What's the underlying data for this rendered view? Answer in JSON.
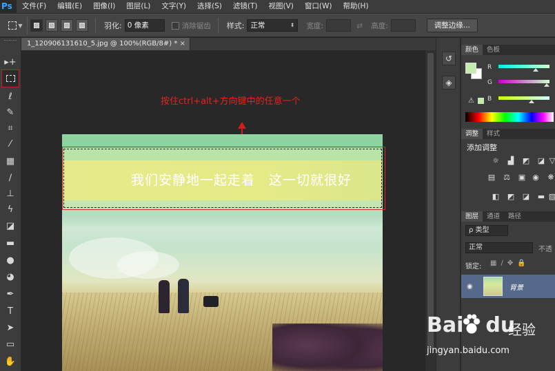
{
  "app": {
    "logo": "Ps"
  },
  "menu": [
    "文件(F)",
    "编辑(E)",
    "图像(I)",
    "图层(L)",
    "文字(Y)",
    "选择(S)",
    "滤镜(T)",
    "视图(V)",
    "窗口(W)",
    "帮助(H)"
  ],
  "options": {
    "feather_label": "羽化:",
    "feather_value": "0 像素",
    "antialias_label": "消除锯齿",
    "style_label": "样式:",
    "style_value": "正常",
    "width_label": "宽度:",
    "height_label": "高度:",
    "refine_edge": "调整边缘..."
  },
  "document": {
    "tab_title": "1_120906131610_5.jpg @ 100%(RGB/8#) *",
    "close": "×",
    "annotation": "按住ctrl+alt+方向键中的任意一个",
    "image_text": "我们安静地一起走着　这一切就很好"
  },
  "panels": {
    "color_tabs": [
      "颜色",
      "色板"
    ],
    "r": "R",
    "g": "G",
    "b": "B",
    "warn": "⚠",
    "adjust_tabs": [
      "调整",
      "样式"
    ],
    "adjust_title": "添加调整",
    "layer_tabs": [
      "图层",
      "通道",
      "路径"
    ],
    "filter_kind": "ρ 类型",
    "blend_mode": "正常",
    "opacity_label": "不透",
    "lock_label": "锁定:",
    "layer_name": "背景"
  },
  "colors": {
    "foreground": "#c4ecb0",
    "selection_border": "#d52a2a",
    "annotation": "#e4241d"
  },
  "watermark": {
    "logo": "Bai",
    "logo2": "du",
    "sub": "经验",
    "url": "jingyan.baidu.com"
  }
}
